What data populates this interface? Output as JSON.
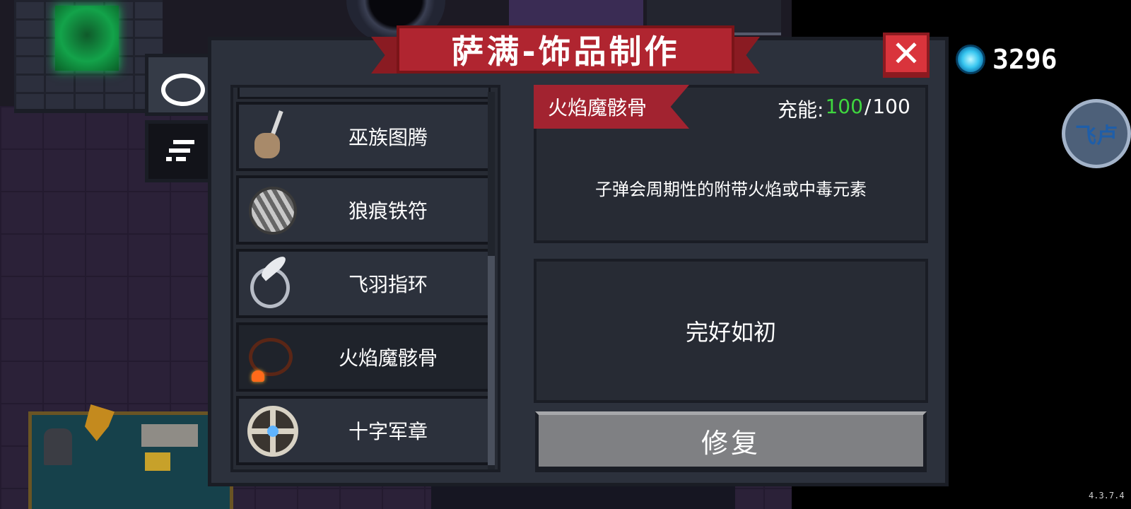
{
  "window": {
    "title": "萨满-饰品制作",
    "close_label": "✕"
  },
  "currency": {
    "icon": "blue-gem-icon",
    "amount": "3296"
  },
  "side_tabs": [
    {
      "name": "accessory-tab",
      "icon": "ring-icon",
      "active": true
    },
    {
      "name": "filter-tab",
      "icon": "filter-icon",
      "active": false
    }
  ],
  "items": [
    {
      "name": "巫族图腾",
      "icon": "totem-icon"
    },
    {
      "name": "狼痕铁符",
      "icon": "claw-disc-icon"
    },
    {
      "name": "飞羽指环",
      "icon": "feather-ring-icon"
    },
    {
      "name": "火焰魔骸骨",
      "icon": "flame-bone-necklace-icon",
      "selected": true
    },
    {
      "name": "十字军章",
      "icon": "cross-badge-icon"
    }
  ],
  "detail": {
    "name": "火焰魔骸骨",
    "charge_label": "充能:",
    "charge_current": "100",
    "charge_sep": "/",
    "charge_max": "100",
    "description": "子弹会周期性的附带火焰或中毒元素",
    "status": "完好如初",
    "action_label": "修复"
  },
  "watermark": {
    "text": "飞卢"
  },
  "version": "4.3.7.4",
  "colors": {
    "panel": "#2c313c",
    "banner": "#b02530",
    "close": "#d9343c",
    "charge_current": "#3fd63f",
    "repair_button": "#7f8083"
  }
}
